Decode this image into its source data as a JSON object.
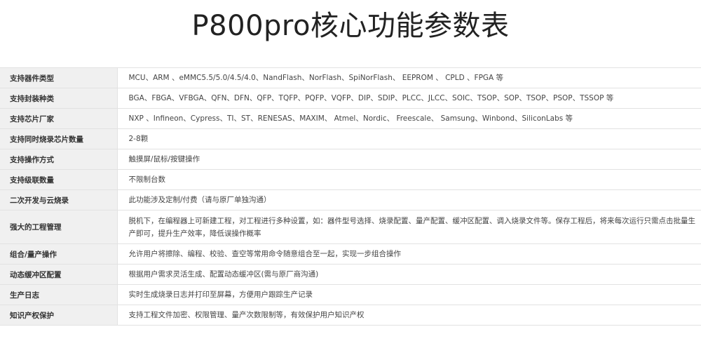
{
  "title": "P800pro核心功能参数表",
  "rows": [
    {
      "label": "支持器件类型",
      "value": "MCU、ARM 、eMMC5.5/5.0/4.5/4.0、NandFlash、NorFlash、SpiNorFlash、 EEPROM 、 CPLD 、FPGA 等"
    },
    {
      "label": "支持封装种类",
      "value": "BGA、FBGA、VFBGA、QFN、DFN、QFP、TQFP、PQFP、VQFP、DIP、SDIP、PLCC、JLCC、SOIC、TSOP、SOP、TSOP、PSOP、TSSOP 等"
    },
    {
      "label": "支持芯片厂家",
      "value": "NXP 、Infineon、Cypress、TI、ST、RENESAS、MAXIM、 Atmel、Nordic、 Freescale、 Samsung、Winbond、SiliconLabs 等"
    },
    {
      "label": "支持同时烧录芯片数量",
      "value": "2-8颗"
    },
    {
      "label": "支持操作方式",
      "value": "触摸屏/鼠标/按键操作"
    },
    {
      "label": "支持级联数量",
      "value": "不限制台数"
    },
    {
      "label": "二次开发与云烧录",
      "value": "此功能涉及定制/付费（请与原厂单独沟通）"
    },
    {
      "label": "强大的工程管理",
      "value": "脱机下，在编程器上可新建工程，对工程进行多种设置，如：器件型号选择、烧录配置、量产配置、缓冲区配置、调入烧录文件等。保存工程后，将来每次运行只需点击批量生产即可，提升生产效率，降低误操作概率"
    },
    {
      "label": "组合/量产操作",
      "value": "允许用户将擦除、编程、校验、查空等常用命令随意组合至一起，实现一步组合操作"
    },
    {
      "label": "动态缓冲区配置",
      "value": "根据用户需求灵活生成、配置动态缓冲区(需与原厂商沟通)"
    },
    {
      "label": "生产日志",
      "value": "实时生成烧录日志并打印至屏幕，方便用户跟踪生产记录"
    },
    {
      "label": "知识产权保护",
      "value": "支持工程文件加密、权限管理、量产次数限制等，有效保护用户知识产权"
    }
  ]
}
